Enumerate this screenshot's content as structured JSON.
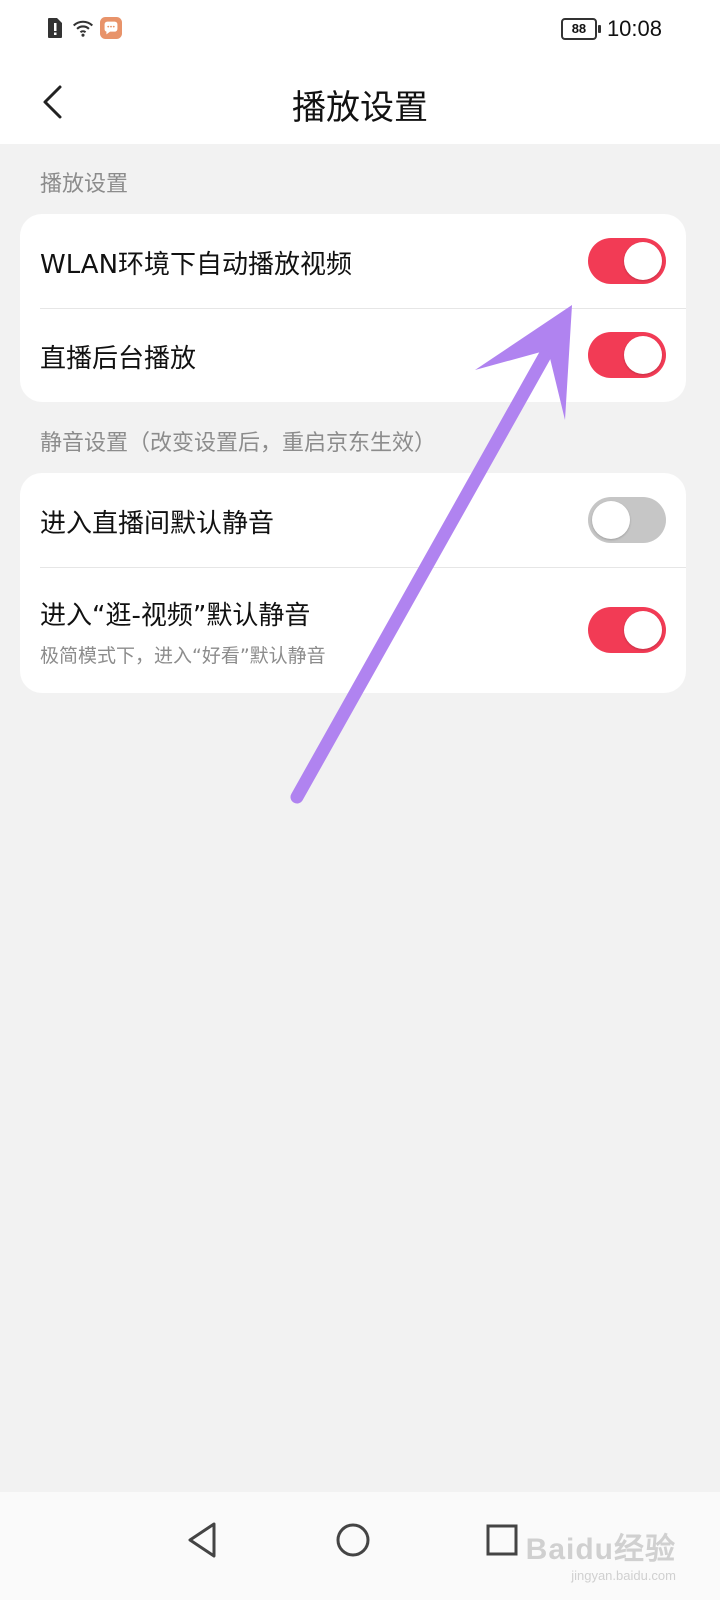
{
  "status_bar": {
    "battery": "88",
    "time": "10:08",
    "icons": [
      "alert-sim-icon",
      "wifi-icon",
      "message-app-icon"
    ]
  },
  "header": {
    "title": "播放设置",
    "back_icon": "chevron-left-icon"
  },
  "sections": [
    {
      "label": "播放设置",
      "items": [
        {
          "label": "WLAN环境下自动播放视频",
          "enabled": true
        },
        {
          "label": "直播后台播放",
          "enabled": true
        }
      ]
    },
    {
      "label": "静音设置（改变设置后，重启京东生效）",
      "items": [
        {
          "label": "进入直播间默认静音",
          "enabled": false
        },
        {
          "label": "进入“逛-视频”默认静音",
          "sublabel": "极简模式下，进入“好看”默认静音",
          "enabled": true
        }
      ]
    }
  ],
  "colors": {
    "toggle_on": "#f23b55",
    "toggle_off": "#c6c6c6",
    "annotation_arrow": "#b083f0"
  },
  "nav_bar": {
    "icons": [
      "back-triangle-icon",
      "home-circle-icon",
      "recents-square-icon"
    ]
  },
  "watermark": {
    "brand": "Baidu经验",
    "url": "jingyan.baidu.com"
  }
}
